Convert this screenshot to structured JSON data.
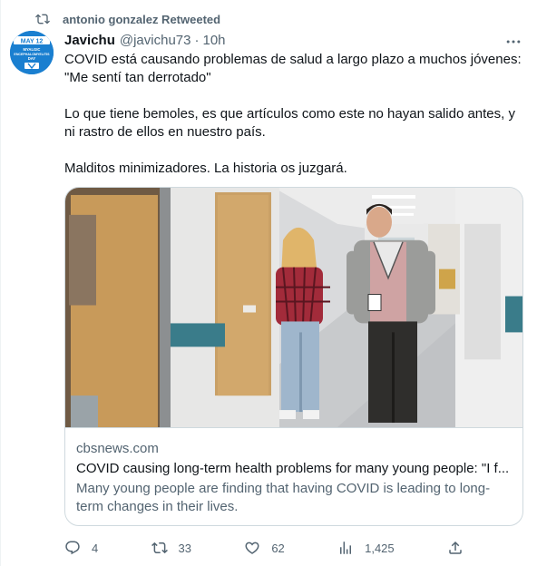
{
  "retweet": {
    "text": "antonio gonzalez Retweeted",
    "icon": "retweet-icon"
  },
  "avatar": {
    "badge_top": "MAY 12",
    "badge_lines": [
      "MYALGIC",
      "ENCEPHALOMYELITIS",
      "DAY"
    ],
    "icon": "awareness-ribbon-avatar"
  },
  "author": {
    "name": "Javichu",
    "handle": "@javichu73",
    "separator": "·",
    "time": "10h"
  },
  "tweet": {
    "line1": "COVID está causando problemas de salud a largo plazo a muchos jóvenes:",
    "line2": "\"Me sentí tan derrotado\"",
    "para2": "Lo que tiene bemoles, es que artículos como este no hayan salido antes, y ni rastro de ellos en nuestro país.",
    "para3": "Malditos minimizadores. La historia os juzgará."
  },
  "card": {
    "domain": "cbsnews.com",
    "title": "COVID causing long-term health problems for many young people: \"I f...",
    "description": "Many young people are finding that having COVID is leading to long-term changes in their lives."
  },
  "actions": {
    "reply_count": "4",
    "retweet_count": "33",
    "like_count": "62",
    "views_count": "1,425"
  },
  "colors": {
    "text": "#0f1419",
    "secondary": "#536471",
    "border": "#cfd9de",
    "brand_blue": "#1d9bf0"
  }
}
